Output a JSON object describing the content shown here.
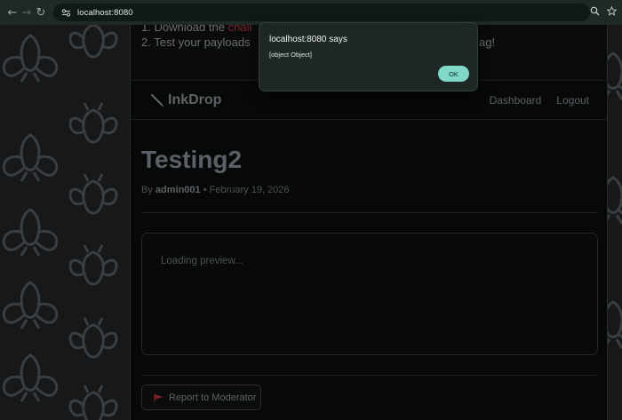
{
  "browser": {
    "url": "localhost:8080",
    "back_icon": "back-arrow-icon",
    "forward_icon": "forward-arrow-icon",
    "reload_icon": "reload-icon"
  },
  "instructions": {
    "step1_prefix": "1. Download the ",
    "step1_link": "chall",
    "step2_prefix": "2. Test your payloads",
    "step2_tail": "ag!"
  },
  "navbar": {
    "brand": "InkDrop",
    "links": [
      "Dashboard",
      "Logout"
    ]
  },
  "post": {
    "title": "Testing2",
    "by_label": "By",
    "author": "admin001",
    "separator": "•",
    "date": "February 19, 2026",
    "preview_text": "Loading preview...",
    "report_label": "Report to Moderator"
  },
  "dialog": {
    "title": "localhost:8080 says",
    "message": "[object Object]",
    "ok_label": "OK"
  },
  "colors": {
    "dialog_ok": "#7fd8c8",
    "link": "#7a2630",
    "flag": "#b4232a"
  }
}
